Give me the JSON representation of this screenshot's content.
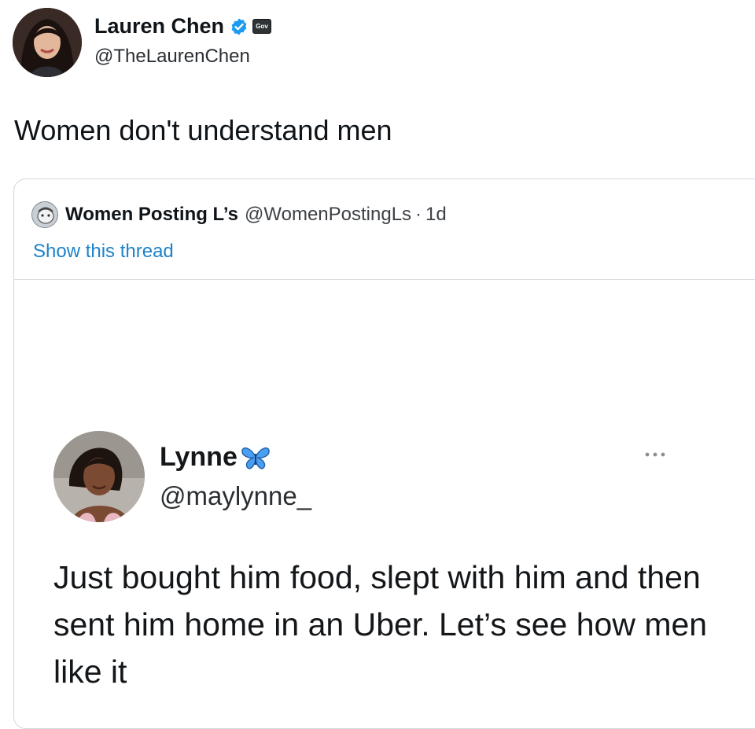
{
  "tweet": {
    "author_name": "Lauren Chen",
    "author_handle": "@TheLaurenChen",
    "verified_icon": "verified-badge-icon",
    "gov_badge_text": "Gov",
    "text": "Women don't understand men"
  },
  "quote": {
    "author_name": "Women Posting L’s",
    "author_handle": "@WomenPostingLs",
    "separator": "·",
    "time": "1d",
    "show_thread_label": "Show this thread",
    "embedded_tweet": {
      "author_name": "Lynne",
      "name_emoji_icon": "butterfly-icon",
      "author_handle": "@maylynne_",
      "text": "Just bought him food, slept with him and then sent him home in an Uber. Let’s see how men like it",
      "more_icon": "more-dots-icon"
    }
  },
  "colors": {
    "link": "#1d83c9",
    "verified": "#1d9bf0",
    "text": "#0f1419",
    "border": "#d3d7db"
  }
}
